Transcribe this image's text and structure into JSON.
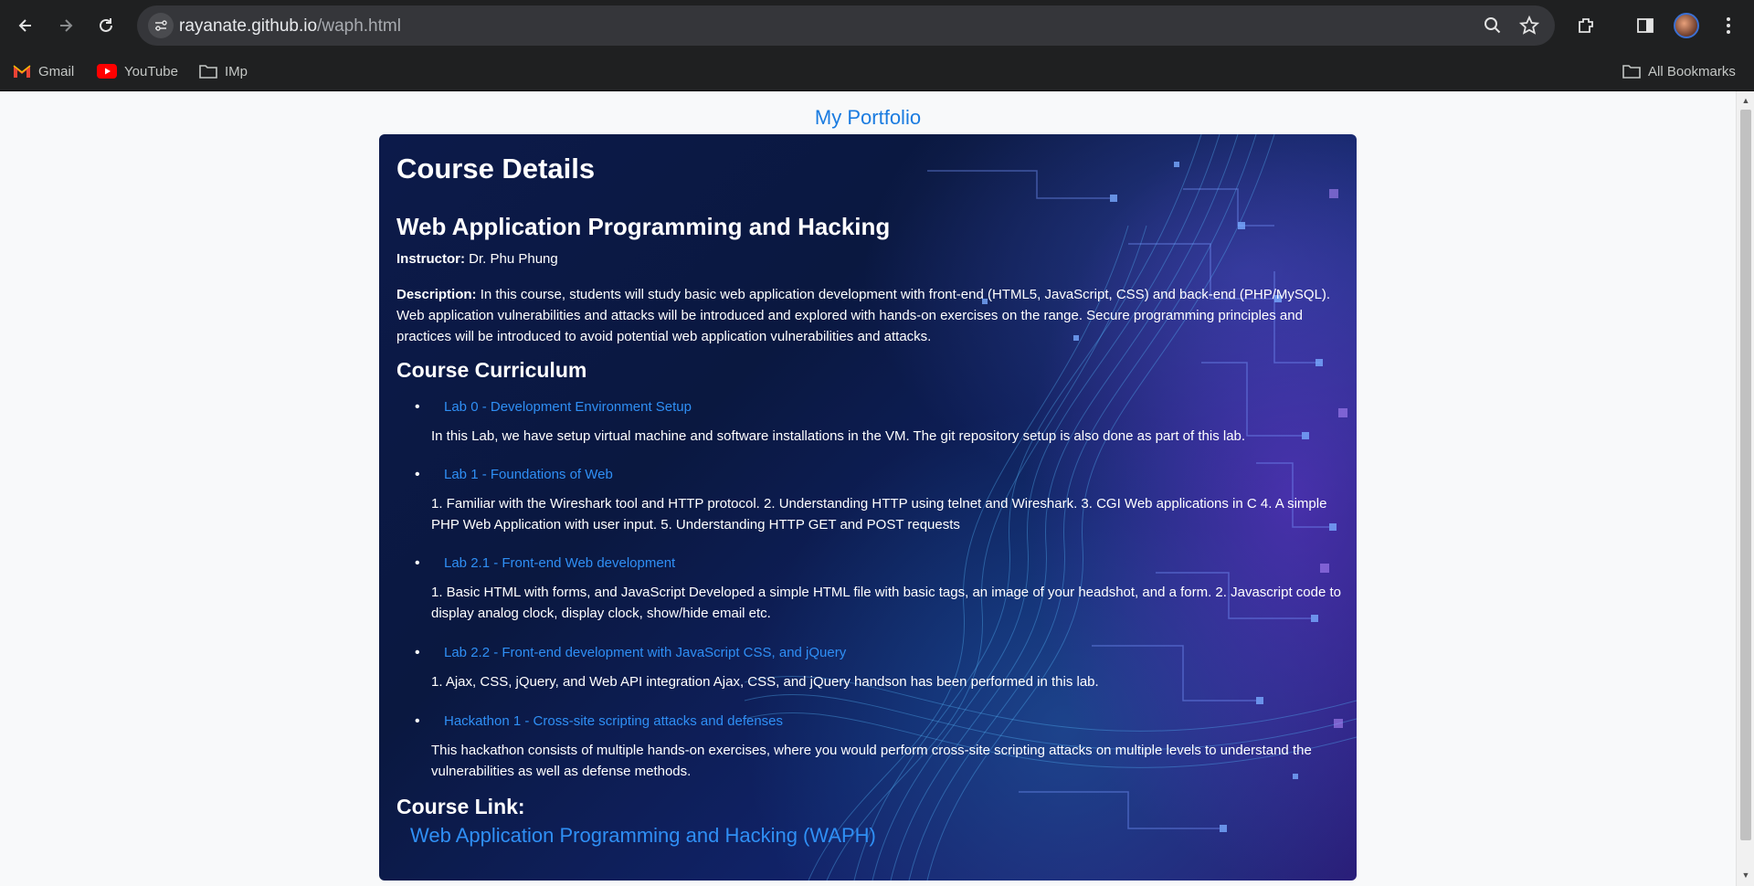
{
  "browser": {
    "url_domain": "rayanate.github.io",
    "url_path": "/waph.html",
    "bookmarks": [
      {
        "label": "Gmail",
        "icon": "gmail-icon"
      },
      {
        "label": "YouTube",
        "icon": "youtube-icon"
      },
      {
        "label": "IMp",
        "icon": "folder-icon"
      }
    ],
    "all_bookmarks": "All Bookmarks"
  },
  "page": {
    "portfolio_title": "My Portfolio",
    "course_details_heading": "Course Details",
    "course_name": "Web Application Programming and Hacking",
    "instructor_label": "Instructor:",
    "instructor_name": "Dr. Phu Phung",
    "description_label": "Description:",
    "description_text": "In this course, students will study basic web application development with front-end (HTML5, JavaScript, CSS) and back-end (PHP/MySQL). Web application vulnerabilities and attacks will be introduced and explored with hands-on exercises on the range. Secure programming principles and practices will be introduced to avoid potential web application vulnerabilities and attacks.",
    "curriculum_heading": "Course Curriculum",
    "labs": [
      {
        "title": "Lab 0 - Development Environment Setup",
        "description": "In this Lab, we have setup virtual machine and software installations in the VM. The git repository setup is also done as part of this lab."
      },
      {
        "title": "Lab 1 - Foundations of Web",
        "description": "1. Familiar with the Wireshark tool and HTTP protocol. 2. Understanding HTTP using telnet and Wireshark. 3. CGI Web applications in C 4. A simple PHP Web Application with user input. 5. Understanding HTTP GET and POST requests"
      },
      {
        "title": "Lab 2.1 - Front-end Web development",
        "description": "1. Basic HTML with forms, and JavaScript Developed a simple HTML file with basic tags, an image of your headshot, and a form. 2. Javascript code to display analog clock, display clock, show/hide email etc."
      },
      {
        "title": "Lab 2.2 - Front-end development with JavaScript CSS, and jQuery",
        "description": "1. Ajax, CSS, jQuery, and Web API integration Ajax, CSS, and jQuery handson has been performed in this lab."
      },
      {
        "title": "Hackathon 1 - Cross-site scripting attacks and defenses",
        "description": "This hackathon consists of multiple hands-on exercises, where you would perform cross-site scripting attacks on multiple levels to understand the vulnerabilities as well as defense methods."
      }
    ],
    "course_link_heading": "Course Link:",
    "course_link_text": "Web Application Programming and Hacking (WAPH)"
  },
  "colors": {
    "link": "#2f8ff5",
    "portfolio_title": "#1a7be0",
    "card_bg_dark": "#0c1a4a",
    "card_accent_purple": "#6e3cdc"
  }
}
